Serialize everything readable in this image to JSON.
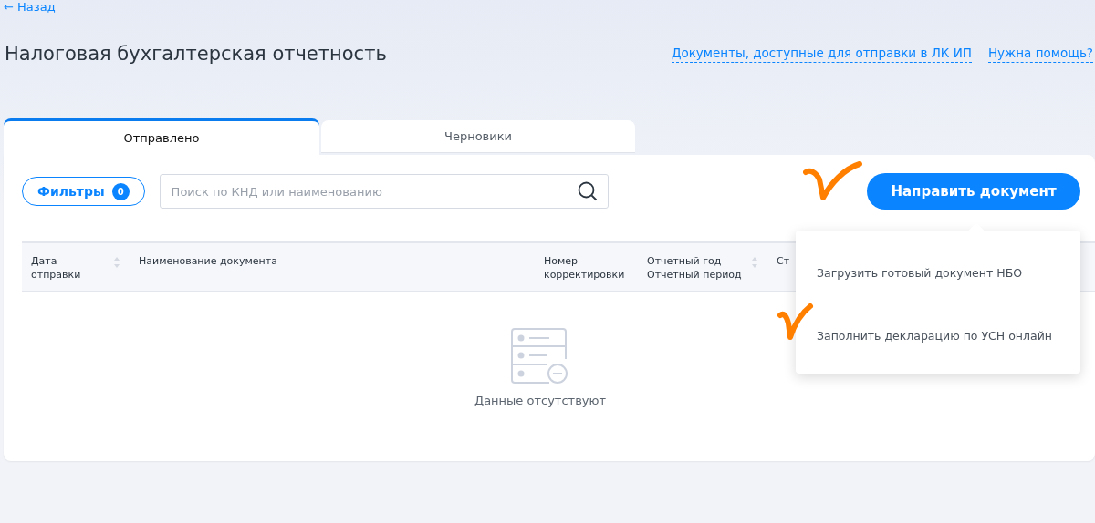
{
  "back_link": {
    "arrow": "←",
    "label": "Назад"
  },
  "title": "Налоговая бухгалтерская отчетность",
  "header_links": [
    "Документы, доступные для отправки в ЛК ИП",
    "Нужна помощь?"
  ],
  "tabs": [
    {
      "label": "Отправлено",
      "selected": true
    },
    {
      "label": "Черновики",
      "selected": false
    }
  ],
  "filters": {
    "label": "Фильтры",
    "count": "0"
  },
  "search": {
    "placeholder": "Поиск по КНД или наименованию"
  },
  "primary_button": "Направить документ",
  "table": {
    "columns": [
      {
        "label": "Дата отправки",
        "sortable": true
      },
      {
        "label": "Наименование документа"
      },
      {
        "label": "Номер корректировки"
      },
      {
        "label": "Отчетный год\nОтчетный период",
        "sortable": true
      },
      {
        "label": "Ст"
      }
    ],
    "empty_text": "Данные отсутствуют"
  },
  "dropdown_menu": [
    "Загрузить готовый документ НБО",
    "Заполнить декларацию по УСН онлайн"
  ]
}
